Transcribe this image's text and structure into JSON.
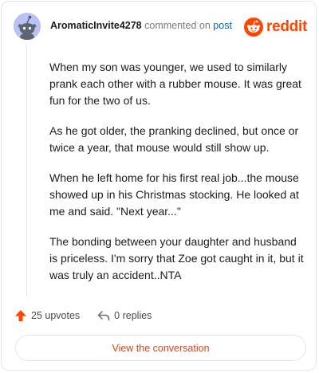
{
  "comment": {
    "username": "AromaticInvite4278",
    "action_text": "commented on",
    "post_link": "post",
    "brand": "reddit",
    "paragraphs": [
      "When my son was younger, we used to similarly prank each other with a rubber mouse. It was great fun for the two of us.",
      "As he got older, the pranking declined, but once or twice a year, that mouse would still show up.",
      "When he left home for his first real job...the mouse showed up in his Christmas stocking. He looked at me and said. \"Next year...\"",
      "The bonding between your daughter and husband is priceless. I'm sorry that Zoe got caught in it, but it was truly an accident..NTA"
    ],
    "upvotes": "25 upvotes",
    "replies": "0 replies",
    "view_button": "View the conversation"
  },
  "colors": {
    "brand_orange": "#ff4500",
    "link_blue": "#0a63c2",
    "avatar_bg": "#b8c2f5",
    "button_text": "#d4451a"
  },
  "icons": {
    "avatar": "snoo-avatar-icon",
    "logo": "reddit-logo-icon",
    "upvote": "upvote-arrow-icon",
    "reply": "reply-arrow-icon"
  }
}
